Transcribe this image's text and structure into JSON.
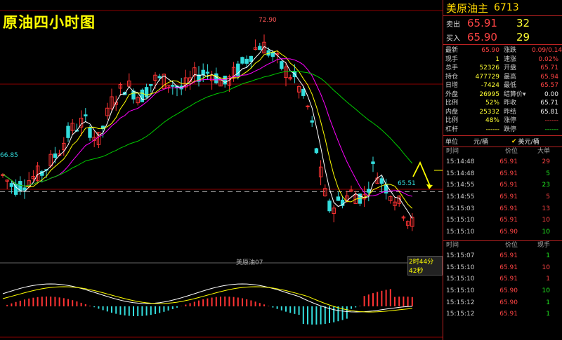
{
  "chart": {
    "title": "原油四小时图",
    "high_label": "72.90",
    "low_label": "65.51",
    "ref_label": "66.85",
    "symbol_label": "美原油07",
    "countdown": "2时44分42秒"
  },
  "colors": {
    "bg": "#000000",
    "up": "#ff3333",
    "down": "#33dddd",
    "ma1": "#ffffff",
    "ma2": "#ffff00",
    "ma3": "#ff00ff",
    "ma4": "#00cc00",
    "grid": "#8b0000",
    "dashed": "#aaaaaa",
    "arrow": "#ffff00"
  },
  "chart_data": {
    "type": "candlestick",
    "price_range": [
      64.5,
      74.0
    ],
    "ref_price": 66.85,
    "high": 72.9,
    "low": 65.51
  },
  "panel": {
    "name": "美原油主",
    "code": "6713",
    "sell": {
      "label": "卖出",
      "price": "65.91",
      "vol": "32"
    },
    "buy": {
      "label": "买入",
      "price": "65.90",
      "vol": "29"
    },
    "stats": [
      {
        "l1": "最新",
        "v1": "65.90",
        "c1": "red",
        "l2": "涨跌",
        "v2": "0.09/0.14%",
        "c2": "red"
      },
      {
        "l1": "现手",
        "v1": "1",
        "c1": "yellow",
        "l2": "速涨",
        "v2": "0.02%",
        "c2": "red"
      },
      {
        "l1": "总手",
        "v1": "52326",
        "c1": "yellow",
        "l2": "开盘",
        "v2": "65.71",
        "c2": "red"
      },
      {
        "l1": "持仓",
        "v1": "477729",
        "c1": "yellow",
        "l2": "最高",
        "v2": "65.94",
        "c2": "red"
      },
      {
        "l1": "日增",
        "v1": "-7424",
        "c1": "yellow",
        "l2": "最低",
        "v2": "65.57",
        "c2": "red"
      },
      {
        "l1": "外盘",
        "v1": "26995",
        "c1": "yellow",
        "l2": "结算价▾",
        "v2": "0.00",
        "c2": "white"
      },
      {
        "l1": "比例",
        "v1": "52%",
        "c1": "yellow",
        "l2": "昨收",
        "v2": "65.71",
        "c2": "white"
      },
      {
        "l1": "内盘",
        "v1": "25332",
        "c1": "yellow",
        "l2": "昨结",
        "v2": "65.81",
        "c2": "white"
      },
      {
        "l1": "比例",
        "v1": "48%",
        "c1": "yellow",
        "l2": "涨停",
        "v2": "------",
        "c2": "red"
      },
      {
        "l1": "杠杆",
        "v1": "------",
        "c1": "yellow",
        "l2": "跌停",
        "v2": "------",
        "c2": "green"
      }
    ],
    "unit": {
      "label": "单位",
      "value": "元/桶",
      "check": "✔",
      "currency": "美元/桶"
    },
    "big_orders": {
      "headers": [
        "时间",
        "价位",
        "大单"
      ],
      "rows": [
        {
          "t": "15:14:48",
          "p": "65.91",
          "v": "29",
          "vc": "red"
        },
        {
          "t": "15:14:48",
          "p": "65.91",
          "v": "5",
          "vc": "green"
        },
        {
          "t": "15:14:55",
          "p": "65.91",
          "v": "23",
          "vc": "green"
        },
        {
          "t": "15:14:55",
          "p": "65.91",
          "v": "5",
          "vc": "red"
        },
        {
          "t": "15:15:03",
          "p": "65.91",
          "v": "13",
          "vc": "red"
        },
        {
          "t": "15:15:10",
          "p": "65.91",
          "v": "10",
          "vc": "red"
        },
        {
          "t": "15:15:10",
          "p": "65.90",
          "v": "10",
          "vc": "green"
        }
      ]
    },
    "ticks": {
      "headers": [
        "时间",
        "价位",
        "现手"
      ],
      "rows": [
        {
          "t": "15:15:07",
          "p": "65.91",
          "v": "1",
          "vc": "green"
        },
        {
          "t": "15:15:10",
          "p": "65.91",
          "v": "10",
          "vc": "red"
        },
        {
          "t": "15:15:10",
          "p": "65.91",
          "v": "1",
          "vc": "red"
        },
        {
          "t": "15:15:10",
          "p": "65.90",
          "v": "10",
          "vc": "green"
        },
        {
          "t": "15:15:12",
          "p": "65.90",
          "v": "1",
          "vc": "green"
        },
        {
          "t": "15:15:12",
          "p": "65.91",
          "v": "1",
          "vc": "green"
        }
      ]
    }
  }
}
